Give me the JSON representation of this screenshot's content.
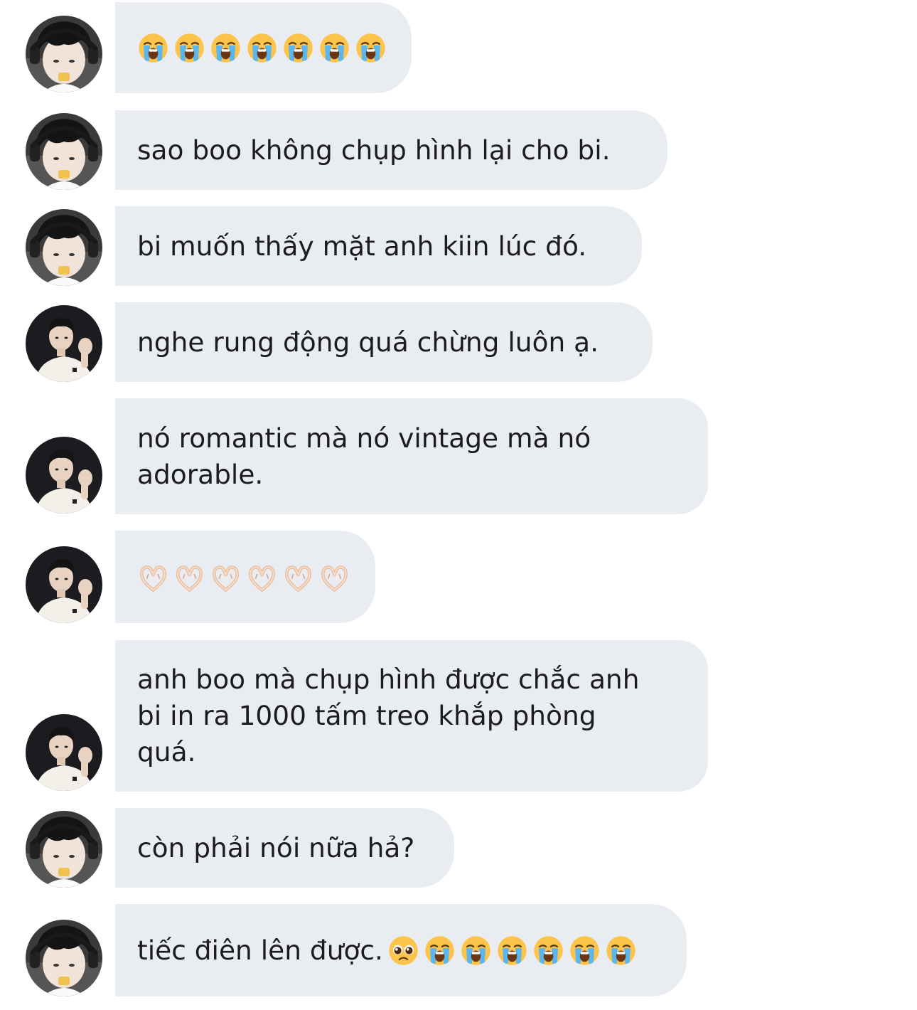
{
  "messages": [
    {
      "sender": "bi",
      "type": "emoji",
      "emojis": [
        "loudly-crying-face",
        "loudly-crying-face",
        "loudly-crying-face",
        "loudly-crying-face",
        "loudly-crying-face",
        "loudly-crying-face",
        "loudly-crying-face"
      ]
    },
    {
      "sender": "bi",
      "type": "text",
      "text": "sao boo không chụp hình lại cho bi."
    },
    {
      "sender": "bi",
      "type": "text",
      "text": "bi muốn thấy mặt anh kiin lúc đó."
    },
    {
      "sender": "kiin",
      "type": "text",
      "text": "nghe rung động quá chừng luôn ạ."
    },
    {
      "sender": "kiin",
      "type": "text",
      "text": "nó romantic mà nó vintage mà nó\nadorable."
    },
    {
      "sender": "kiin",
      "type": "emoji",
      "emojis": [
        "heart-hands",
        "heart-hands",
        "heart-hands",
        "heart-hands",
        "heart-hands",
        "heart-hands"
      ]
    },
    {
      "sender": "kiin",
      "type": "text",
      "text": "anh boo mà chụp hình được chắc anh\nbi in ra 1000 tấm treo khắp phòng\nquá."
    },
    {
      "sender": "bi",
      "type": "text",
      "text": "còn phải nói nữa hả?"
    },
    {
      "sender": "bi",
      "type": "text",
      "text": "tiếc điên lên được.",
      "trailing_emojis": [
        "pleading-face",
        "loudly-crying-face",
        "loudly-crying-face",
        "loudly-crying-face",
        "loudly-crying-face",
        "loudly-crying-face",
        "loudly-crying-face"
      ]
    }
  ],
  "colors": {
    "bubble": "#e9edf2",
    "text": "#1c1c1e",
    "background": "#ffffff"
  }
}
